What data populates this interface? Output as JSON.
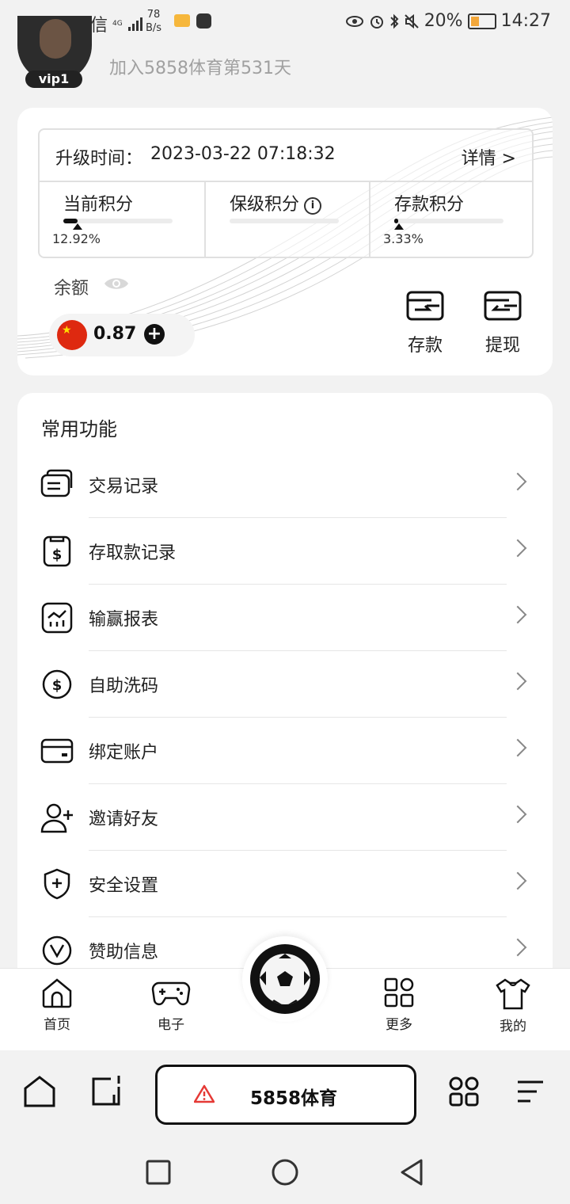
{
  "status_bar": {
    "carrier": "中国电信",
    "network": "4G",
    "speed_value": "78",
    "speed_unit": "B/s",
    "battery": "20%",
    "time": "14:27"
  },
  "header": {
    "vip_badge": "vip1",
    "join_text": "加入5858体育第531天"
  },
  "vip_card": {
    "upgrade_label": "升级时间：",
    "upgrade_time": "2023-03-22 07:18:32",
    "detail_link": "详情 >",
    "points": [
      {
        "label": "当前积分",
        "percent_text": "12.92%",
        "progress": 0.1292
      },
      {
        "label": "保级积分",
        "percent_text": "",
        "progress": 0
      },
      {
        "label": "存款积分",
        "percent_text": "3.33%",
        "progress": 0.0333
      }
    ],
    "balance_label": "余额",
    "balance_value": "0.87",
    "deposit_label": "存款",
    "withdraw_label": "提现"
  },
  "functions": {
    "title": "常用功能",
    "items": [
      {
        "label": "交易记录",
        "icon": "transaction-records-icon"
      },
      {
        "label": "存取款记录",
        "icon": "deposit-withdraw-records-icon"
      },
      {
        "label": "输赢报表",
        "icon": "win-loss-report-icon"
      },
      {
        "label": "自助洗码",
        "icon": "self-rebate-icon"
      },
      {
        "label": "绑定账户",
        "icon": "bind-account-icon"
      },
      {
        "label": "邀请好友",
        "icon": "invite-friend-icon"
      },
      {
        "label": "安全设置",
        "icon": "security-settings-icon"
      },
      {
        "label": "赞助信息",
        "icon": "sponsor-info-icon"
      }
    ]
  },
  "tabbar": {
    "home": "首页",
    "electronic": "电子",
    "more": "更多",
    "mine": "我的"
  },
  "browser": {
    "url_title": "5858体育"
  },
  "colors": {
    "accent": "#111111",
    "background": "#f2f2f2",
    "card": "#ffffff",
    "warning": "#e53935"
  }
}
